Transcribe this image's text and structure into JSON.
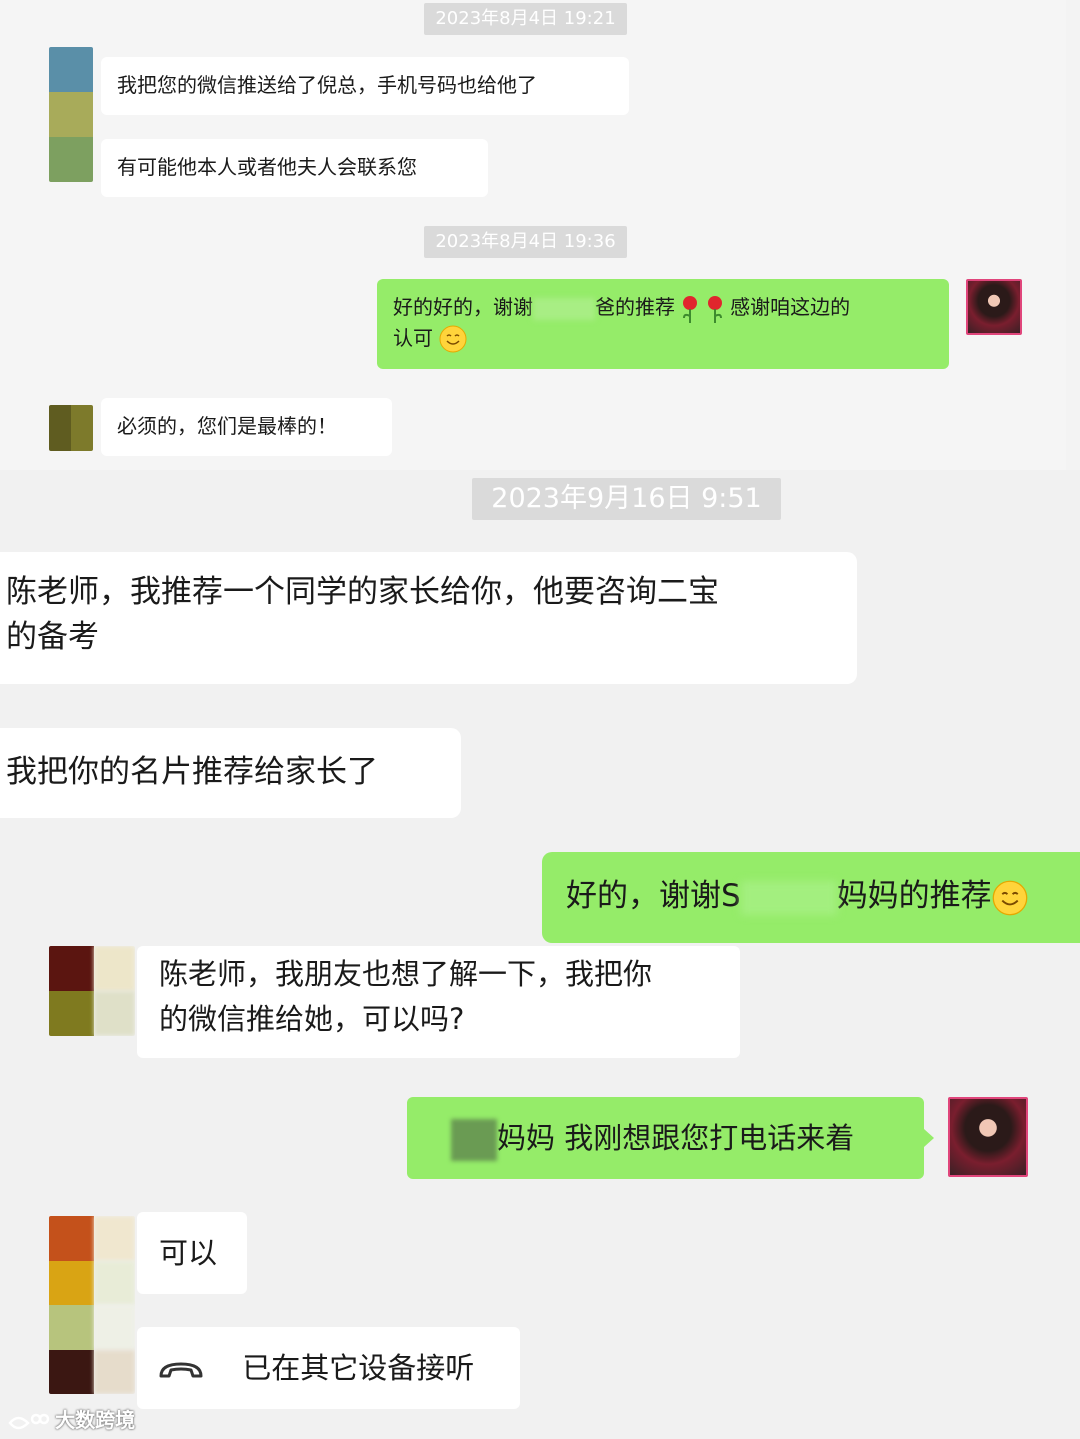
{
  "top_section": {
    "timestamp_1": "2023年8月4日 19:21",
    "msg_1": "我把您的微信推送给了倪总，手机号码也给他了",
    "msg_2": "有可能他本人或者他夫人会联系您",
    "timestamp_2": "2023年8月4日 19:36",
    "reply_1_part_a": "好的好的，谢谢",
    "reply_1_part_b": "爸的推荐",
    "reply_1_part_c": "感谢咱这边的",
    "reply_1_line2": "认可",
    "msg_3": "必须的，您们是最棒的！"
  },
  "bottom_section": {
    "timestamp_3": "2023年9月16日 9:51",
    "msg_4": "陈老师，我推荐一个同学的家长给你，他要咨询二宝\n的备考",
    "msg_5": "我把你的名片推荐给家长了",
    "reply_2_part_a": "好的，谢谢S",
    "reply_2_part_b": "妈妈的推荐",
    "msg_6": "陈老师，我朋友也想了解一下，我把你\n的微信推给她，可以吗?",
    "reply_3": "妈妈 我刚想跟您打电话来着",
    "msg_7": "可以",
    "msg_8": "已在其它设备接听"
  },
  "icons": {
    "rose": "rose-emoji-icon",
    "smile": "smile-emoji-icon",
    "call": "phone-handset-icon",
    "watermark_logo": "eye-logo-icon"
  },
  "watermark": "大数跨境",
  "colors": {
    "self_bubble": "#95ec69",
    "other_bubble": "#ffffff",
    "timestamp_bg": "#dadada",
    "background": "#f3f3f3"
  }
}
